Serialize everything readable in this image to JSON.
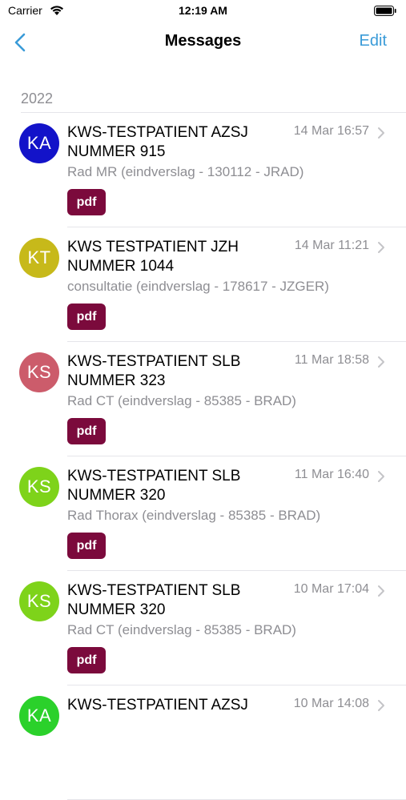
{
  "status_bar": {
    "carrier": "Carrier",
    "time": "12:19 AM"
  },
  "nav": {
    "title": "Messages",
    "edit_label": "Edit",
    "accent_color": "#3a9bd8"
  },
  "section": {
    "header": "2022"
  },
  "messages": [
    {
      "initials": "KA",
      "avatar_color": "#1313c9",
      "title": "KWS-TESTPATIENT AZSJ NUMMER 915",
      "time": "14 Mar 16:57",
      "subtitle": "Rad MR (eindverslag - 130112 - JRAD)",
      "attachment": "pdf"
    },
    {
      "initials": "KT",
      "avatar_color": "#c7b91a",
      "title": "KWS TESTPATIENT JZH NUMMER 1044",
      "time": "14 Mar 11:21",
      "subtitle": "consultatie (eindverslag - 178617 - JZGER)",
      "attachment": "pdf"
    },
    {
      "initials": "KS",
      "avatar_color": "#cc5c6b",
      "title": "KWS-TESTPATIENT SLB NUMMER 323",
      "time": "11 Mar 18:58",
      "subtitle": "Rad CT (eindverslag - 85385 - BRAD)",
      "attachment": "pdf"
    },
    {
      "initials": "KS",
      "avatar_color": "#7ed31a",
      "title": "KWS-TESTPATIENT SLB NUMMER 320",
      "time": "11 Mar 16:40",
      "subtitle": "Rad Thorax (eindverslag - 85385 - BRAD)",
      "attachment": "pdf"
    },
    {
      "initials": "KS",
      "avatar_color": "#7ed31a",
      "title": "KWS-TESTPATIENT SLB NUMMER 320",
      "time": "10 Mar 17:04",
      "subtitle": "Rad CT (eindverslag - 85385 - BRAD)",
      "attachment": "pdf"
    },
    {
      "initials": "KA",
      "avatar_color": "#2bd12b",
      "title": "KWS-TESTPATIENT AZSJ",
      "time": "10 Mar 14:08",
      "subtitle": "",
      "attachment": ""
    }
  ],
  "attachment_color": "#7b0a3c"
}
